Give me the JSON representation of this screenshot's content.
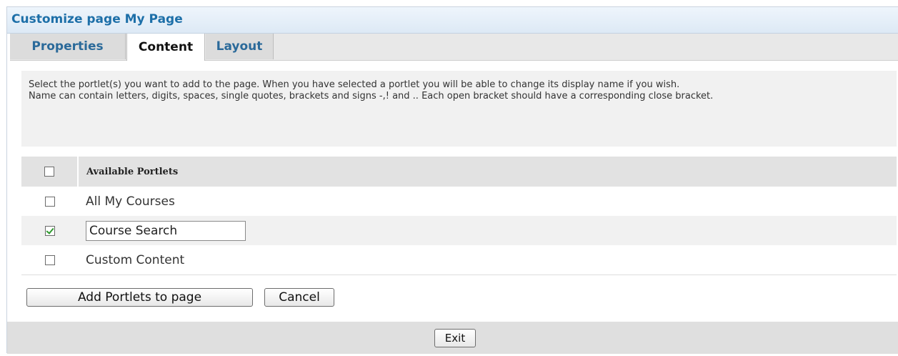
{
  "dialog": {
    "title": "Customize page My Page"
  },
  "tabs": [
    {
      "label": "Properties",
      "active": false
    },
    {
      "label": "Content",
      "active": true
    },
    {
      "label": "Layout",
      "active": false
    }
  ],
  "info": {
    "line1": "Select the portlet(s) you want to add to the page. When you have selected a portlet you will be able to change its display name if you wish.",
    "line2": "Name can contain letters, digits, spaces, single quotes, brackets and signs -,! and .. Each open bracket should have a corresponding close bracket."
  },
  "table": {
    "header": "Available Portlets",
    "select_all_checked": false,
    "rows": [
      {
        "name": "All My Courses",
        "checked": false
      },
      {
        "name": "Course Search",
        "checked": true,
        "editable_value": "Course Search"
      },
      {
        "name": "Custom Content",
        "checked": false
      }
    ]
  },
  "actions": {
    "add_label": "Add Portlets to page",
    "cancel_label": "Cancel",
    "exit_label": "Exit"
  },
  "colors": {
    "title_text": "#1d6fa8",
    "tab_inactive_text": "#2b6a9a",
    "checkmark": "#2e9a2e",
    "panel_gray": "#f1f1f1",
    "header_gray": "#e2e2e2",
    "footer_gray": "#dfdfdf"
  }
}
